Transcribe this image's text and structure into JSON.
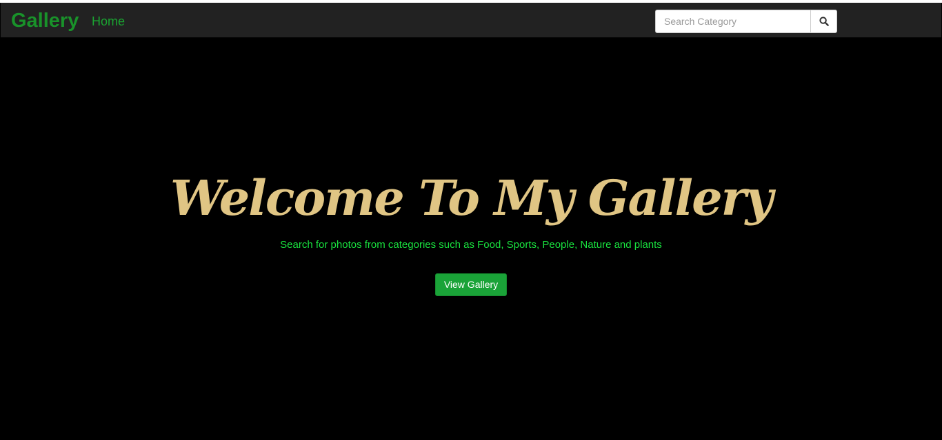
{
  "navbar": {
    "brand": "Gallery",
    "home_label": "Home",
    "search": {
      "placeholder": "Search Category",
      "value": "",
      "button_icon": "search-icon"
    }
  },
  "hero": {
    "title": "Welcome To My Gallery",
    "subtitle": "Search for photos from categories such as Food, Sports, People, Nature and plants",
    "button_label": "View Gallery"
  },
  "colors": {
    "background": "#000000",
    "navbar_bg": "#222222",
    "brand_green": "#19922a",
    "title_gold": "#e0c584",
    "subtitle_green": "#19e33f",
    "button_green": "#1aa338"
  }
}
